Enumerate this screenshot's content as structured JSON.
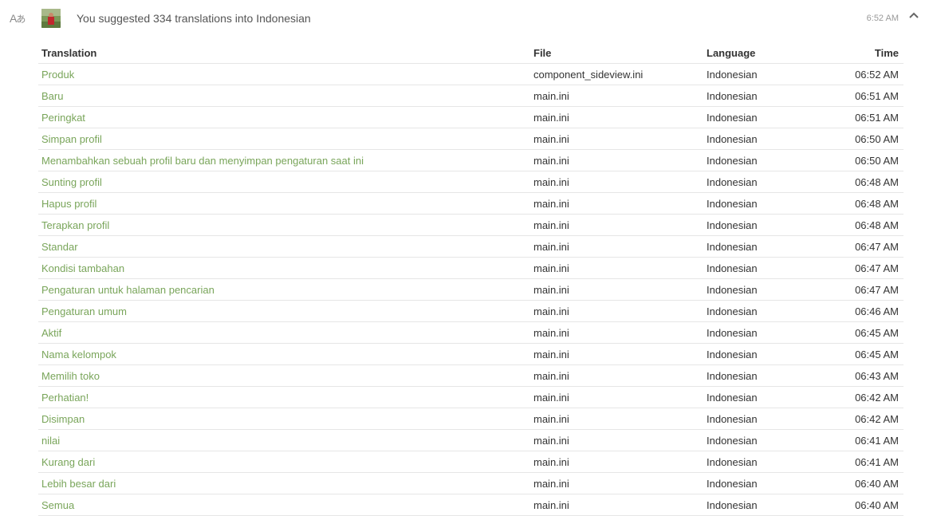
{
  "header": {
    "icon": "translate-icon",
    "avatar": "avatar",
    "summary": "You suggested 334 translations into Indonesian",
    "time": "6:52 AM",
    "collapse_icon": "chevron-up-icon"
  },
  "colors": {
    "link": "#79a55a",
    "divider": "#e6e6e6",
    "muted": "#9a9a9a"
  },
  "table": {
    "columns": {
      "translation": "Translation",
      "file": "File",
      "language": "Language",
      "time": "Time"
    },
    "rows": [
      {
        "translation": "Produk",
        "file": "component_sideview.ini",
        "language": "Indonesian",
        "time": "06:52 AM"
      },
      {
        "translation": "Baru",
        "file": "main.ini",
        "language": "Indonesian",
        "time": "06:51 AM"
      },
      {
        "translation": "Peringkat",
        "file": "main.ini",
        "language": "Indonesian",
        "time": "06:51 AM"
      },
      {
        "translation": "Simpan profil",
        "file": "main.ini",
        "language": "Indonesian",
        "time": "06:50 AM"
      },
      {
        "translation": "Menambahkan sebuah profil baru dan menyimpan pengaturan saat ini",
        "file": "main.ini",
        "language": "Indonesian",
        "time": "06:50 AM"
      },
      {
        "translation": "Sunting profil",
        "file": "main.ini",
        "language": "Indonesian",
        "time": "06:48 AM"
      },
      {
        "translation": "Hapus profil",
        "file": "main.ini",
        "language": "Indonesian",
        "time": "06:48 AM"
      },
      {
        "translation": "Terapkan profil",
        "file": "main.ini",
        "language": "Indonesian",
        "time": "06:48 AM"
      },
      {
        "translation": "Standar",
        "file": "main.ini",
        "language": "Indonesian",
        "time": "06:47 AM"
      },
      {
        "translation": "Kondisi tambahan",
        "file": "main.ini",
        "language": "Indonesian",
        "time": "06:47 AM"
      },
      {
        "translation": "Pengaturan untuk halaman pencarian",
        "file": "main.ini",
        "language": "Indonesian",
        "time": "06:47 AM"
      },
      {
        "translation": "Pengaturan umum",
        "file": "main.ini",
        "language": "Indonesian",
        "time": "06:46 AM"
      },
      {
        "translation": "Aktif",
        "file": "main.ini",
        "language": "Indonesian",
        "time": "06:45 AM"
      },
      {
        "translation": "Nama kelompok",
        "file": "main.ini",
        "language": "Indonesian",
        "time": "06:45 AM"
      },
      {
        "translation": "Memilih toko",
        "file": "main.ini",
        "language": "Indonesian",
        "time": "06:43 AM"
      },
      {
        "translation": "Perhatian!",
        "file": "main.ini",
        "language": "Indonesian",
        "time": "06:42 AM"
      },
      {
        "translation": "Disimpan",
        "file": "main.ini",
        "language": "Indonesian",
        "time": "06:42 AM"
      },
      {
        "translation": "nilai",
        "file": "main.ini",
        "language": "Indonesian",
        "time": "06:41 AM"
      },
      {
        "translation": "Kurang dari",
        "file": "main.ini",
        "language": "Indonesian",
        "time": "06:41 AM"
      },
      {
        "translation": "Lebih besar dari",
        "file": "main.ini",
        "language": "Indonesian",
        "time": "06:40 AM"
      },
      {
        "translation": "Semua",
        "file": "main.ini",
        "language": "Indonesian",
        "time": "06:40 AM"
      }
    ]
  }
}
